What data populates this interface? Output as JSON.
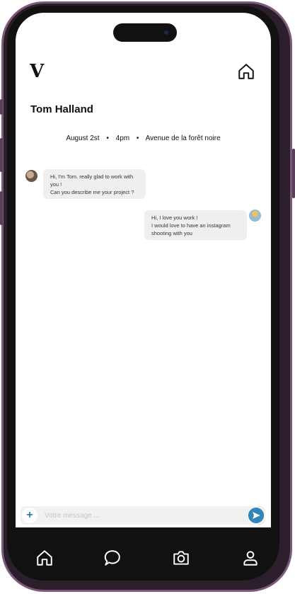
{
  "header": {
    "logo_text": "V"
  },
  "chat": {
    "contact_name": "Tom Halland",
    "meta": {
      "date": "August 2st",
      "time": "4pm",
      "location": "Avenue de la forêt noire"
    },
    "messages": [
      {
        "from": "contact",
        "text": "Hi, I'm Tom. really glad to work with\nyou !\nCan you describe me your project ?"
      },
      {
        "from": "me",
        "text": "Hi, I love you work !\nI would love to have an instagram\nshooting with you"
      }
    ]
  },
  "composer": {
    "placeholder": "Votre message ...",
    "value": ""
  },
  "icons": {
    "top_right": "home-icon",
    "nav": [
      "home-icon",
      "chat-bubble-icon",
      "camera-icon",
      "user-icon"
    ],
    "composer": [
      "plus-icon",
      "send-icon"
    ]
  },
  "colors": {
    "frame": "#7d5a7c",
    "accent": "#2f86b8",
    "bubble": "#efefef"
  }
}
